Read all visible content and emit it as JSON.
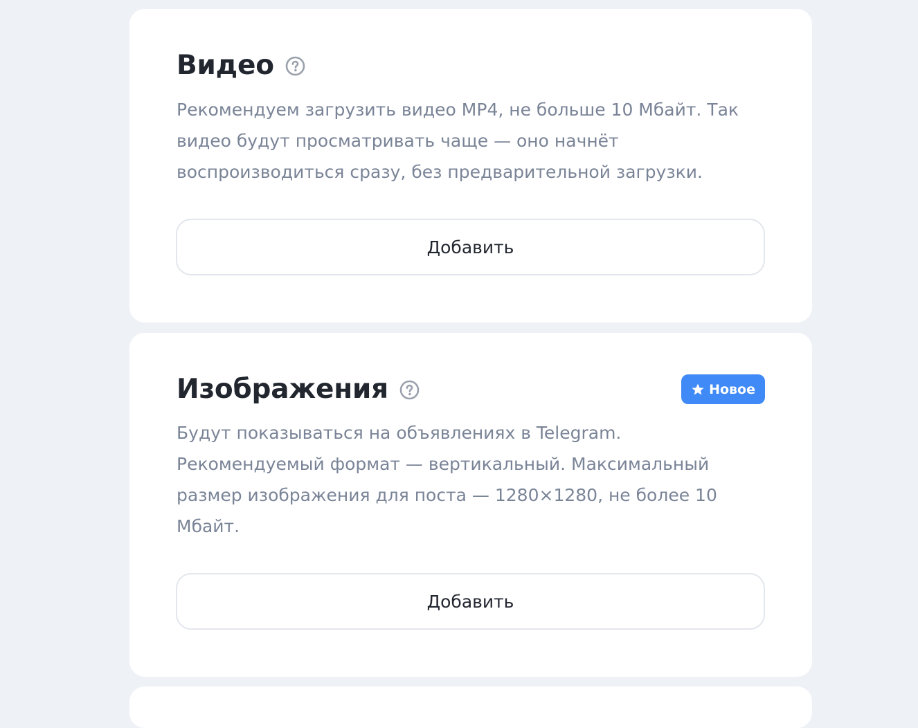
{
  "sections": [
    {
      "title": "Видео",
      "help_icon": "question-circle-icon",
      "description": "Рекомендуем загрузить видео MP4, не больше 10 Мбайт. Так видео будут просматривать чаще — оно начнёт воспроизводиться сразу, без предварительной загрузки.",
      "add_label": "Добавить"
    },
    {
      "title": "Изображения",
      "help_icon": "question-circle-icon",
      "badge": {
        "icon": "star-icon",
        "label": "Новое",
        "color": "#3f8af7"
      },
      "description": "Будут показываться на объявлениях в Telegram. Рекомендуемый формат — вертикальный. Максимальный размер изображения для поста — 1280×1280, не более 10 Мбайт.",
      "add_label": "Добавить"
    }
  ],
  "colors": {
    "background": "#eef1f5",
    "card": "#ffffff",
    "title": "#21262f",
    "description": "#7a8497",
    "badge": "#3f8af7"
  }
}
